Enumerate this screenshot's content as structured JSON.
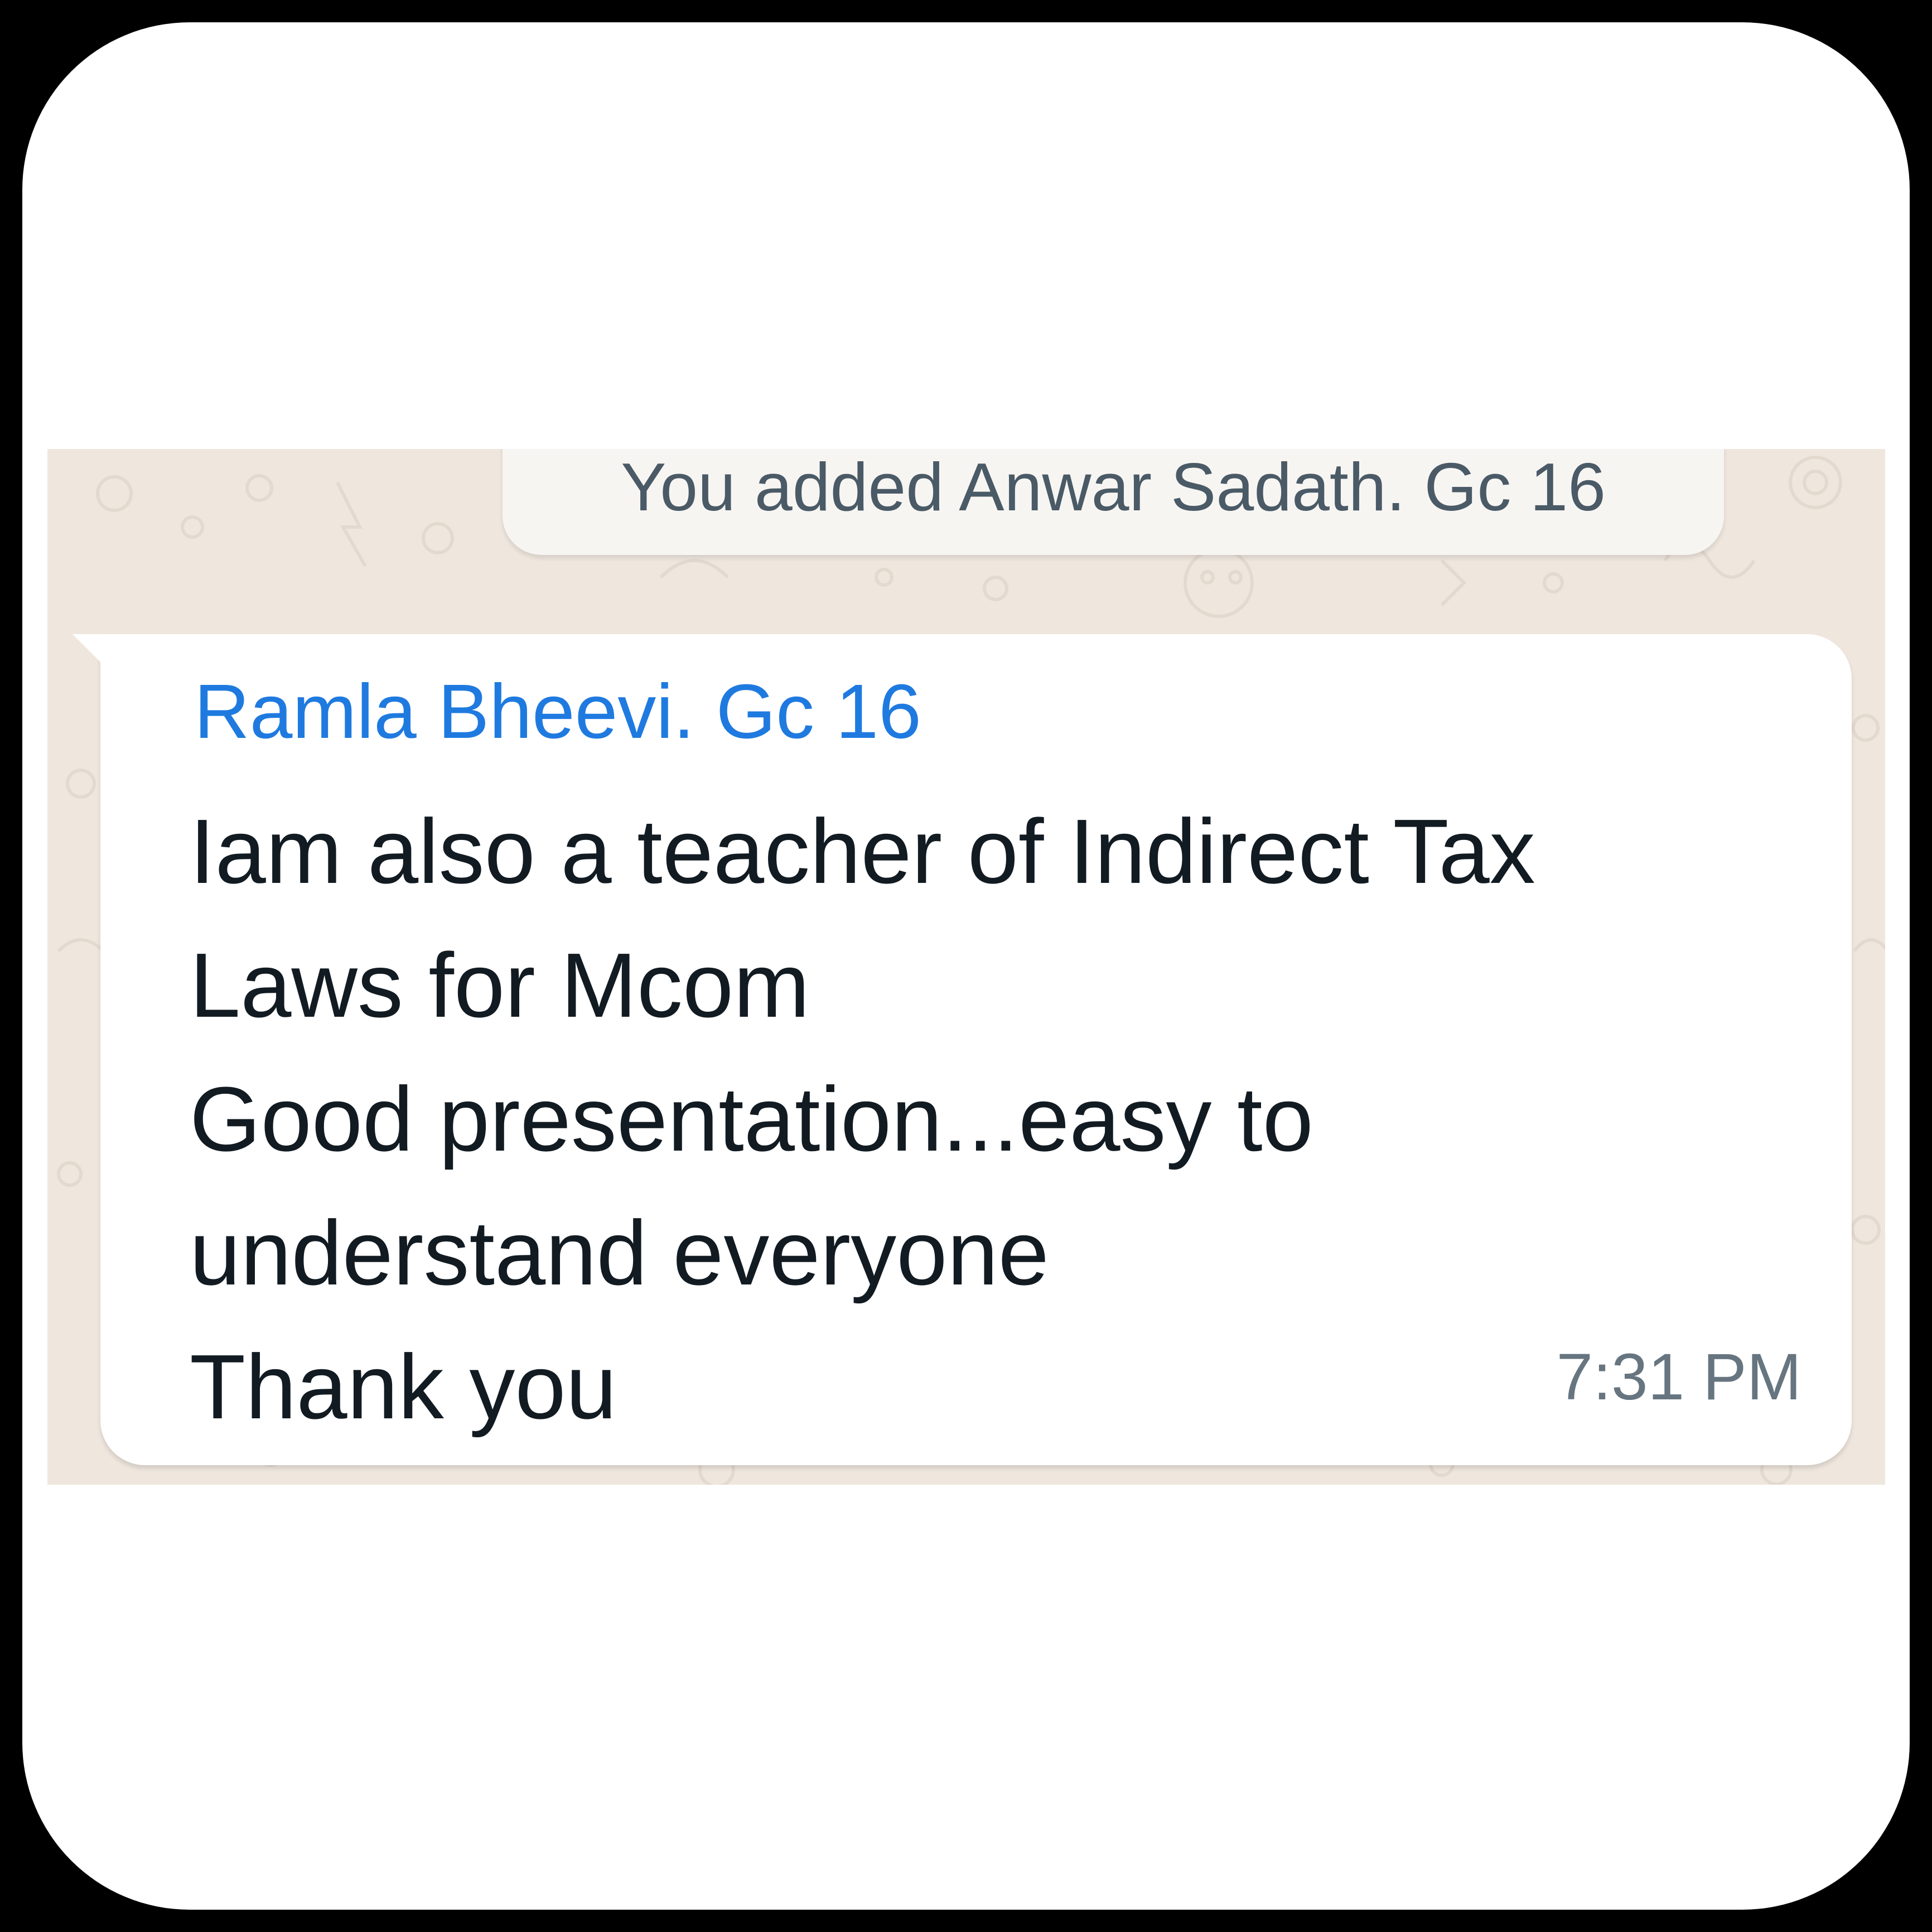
{
  "system_message": {
    "text": "You added Anwar Sadath. Gc 16"
  },
  "message": {
    "sender": "Ramla Bheevi. Gc 16",
    "lines": [
      "Iam also a teacher of Indirect Tax",
      "Laws for Mcom",
      "Good presentation...easy to",
      "understand everyone",
      "Thank you"
    ],
    "time": "7:31 PM"
  },
  "colors": {
    "frame": "#000000",
    "card": "#ffffff",
    "chat_background": "#efe7de",
    "sender_name": "#1f7ae0",
    "message_text": "#121b22",
    "timestamp": "#66757f"
  }
}
